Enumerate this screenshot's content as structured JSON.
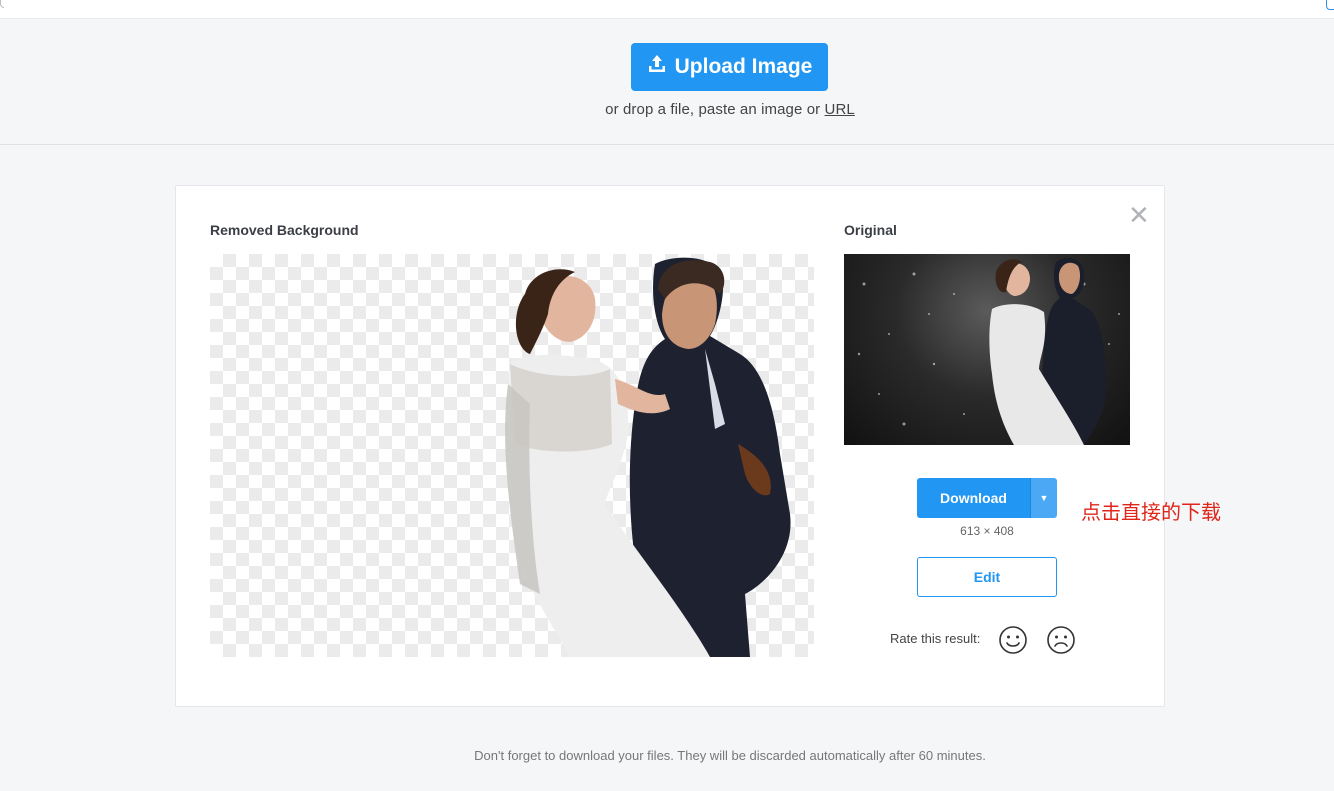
{
  "colors": {
    "primary": "#2196f3",
    "annotation": "#e0261b",
    "page_bg": "#f4f6f8"
  },
  "upload": {
    "button_label": "Upload Image",
    "icon": "upload-icon",
    "hint_prefix": "or drop a file, paste an image or",
    "hint_link": "URL"
  },
  "result": {
    "removed_label": "Removed Background",
    "original_label": "Original",
    "close_icon": "close-icon",
    "download_label": "Download",
    "download_menu_icon": "caret-down-icon",
    "resolution": "613 × 408",
    "edit_label": "Edit",
    "rate_label": "Rate this result:",
    "rate_icons": [
      "smile-icon",
      "frown-icon"
    ]
  },
  "annotation_text": "点击直接的下载",
  "footer": "Don't forget to download your files. They will be discarded automatically after 60 minutes."
}
